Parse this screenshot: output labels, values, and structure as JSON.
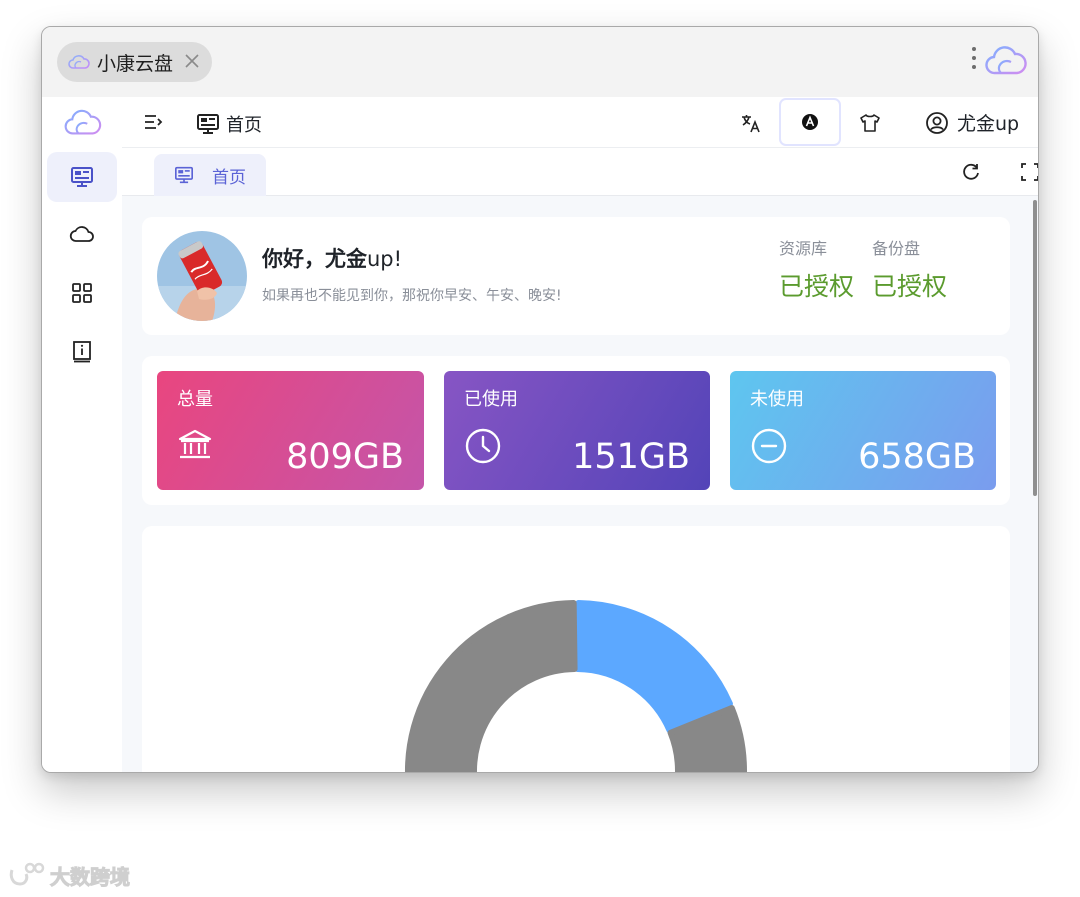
{
  "window": {
    "tab_title": "小康云盘"
  },
  "header": {
    "breadcrumb": "首页",
    "user_name": "尤金up"
  },
  "tabs": [
    {
      "label": "首页",
      "active": true
    }
  ],
  "sidebar": {
    "items": [
      {
        "icon": "monitor-icon",
        "active": true
      },
      {
        "icon": "cloud-icon",
        "active": false
      },
      {
        "icon": "apps-grid-icon",
        "active": false
      },
      {
        "icon": "info-book-icon",
        "active": false
      }
    ]
  },
  "welcome": {
    "greeting_prefix": "你好，尤金",
    "greeting_suffix": "up!",
    "subtitle": "如果再也不能见到你，那祝你早安、午安、晚安!",
    "stats": [
      {
        "label": "资源库",
        "value": "已授权"
      },
      {
        "label": "备份盘",
        "value": "已授权"
      }
    ]
  },
  "storage": {
    "cards": [
      {
        "label": "总量",
        "value": "809GB",
        "icon": "bank-icon"
      },
      {
        "label": "已使用",
        "value": "151GB",
        "icon": "clock-icon"
      },
      {
        "label": "未使用",
        "value": "658GB",
        "icon": "minus-circle-icon"
      }
    ]
  },
  "chart_data": {
    "type": "pie",
    "variant": "donut",
    "series": [
      {
        "value": 151,
        "color": "#5ca8ff"
      },
      {
        "value": 658,
        "color": "#888888"
      }
    ]
  },
  "colors": {
    "accent": "#5b63d6",
    "authorized_green": "#5b9b2e",
    "donut_used": "#5ca8ff",
    "donut_free": "#888888"
  }
}
